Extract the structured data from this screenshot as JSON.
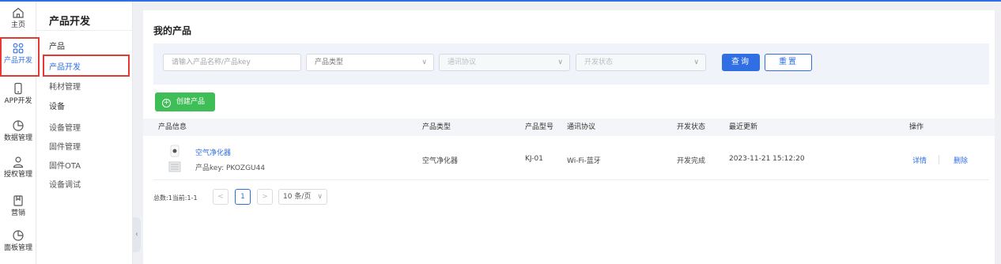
{
  "rail": [
    {
      "label": "主页",
      "icon": "home-icon"
    },
    {
      "label": "产品开发",
      "icon": "grid-icon"
    },
    {
      "label": "APP开发",
      "icon": "phone-icon"
    },
    {
      "label": "数据管理",
      "icon": "pie-chart-icon"
    },
    {
      "label": "授权管理",
      "icon": "user-icon"
    },
    {
      "label": "营销",
      "icon": "bookmark-icon"
    },
    {
      "label": "面板管理",
      "icon": "pie-chart-icon"
    }
  ],
  "subnav": {
    "title": "产品开发",
    "group1": "产品",
    "group1_items": [
      "产品开发",
      "耗材管理"
    ],
    "group2": "设备",
    "group2_items": [
      "设备管理",
      "固件管理",
      "固件OTA",
      "设备调试"
    ]
  },
  "main": {
    "title": "我的产品",
    "filters": {
      "search_placeholder": "请输入产品名称/产品key",
      "product_type": "产品类型",
      "protocol": "通讯协议",
      "dev_status": "开发状态",
      "query_label": "查询",
      "reset_label": "重置"
    },
    "create_label": "创建产品",
    "table": {
      "headers": [
        "产品信息",
        "产品类型",
        "产品型号",
        "通讯协议",
        "开发状态",
        "最近更新",
        "操作"
      ],
      "rows": [
        {
          "name": "空气净化器",
          "key": "产品key: PKOZGU44",
          "type": "空气净化器",
          "model": "KJ-01",
          "protocol": "Wi-Fi-蓝牙",
          "status": "开发完成",
          "updated": "2023-11-21 15:12:20",
          "actions": [
            "详情",
            "删除"
          ]
        }
      ]
    },
    "pager": {
      "summary": "总数:1当前:1-1",
      "prev": "<",
      "current": "1",
      "next": ">",
      "size": "10 条/页"
    }
  },
  "colors": {
    "accent": "#2f6fe3",
    "create": "#3fbe57",
    "highlight": "#e53935"
  }
}
